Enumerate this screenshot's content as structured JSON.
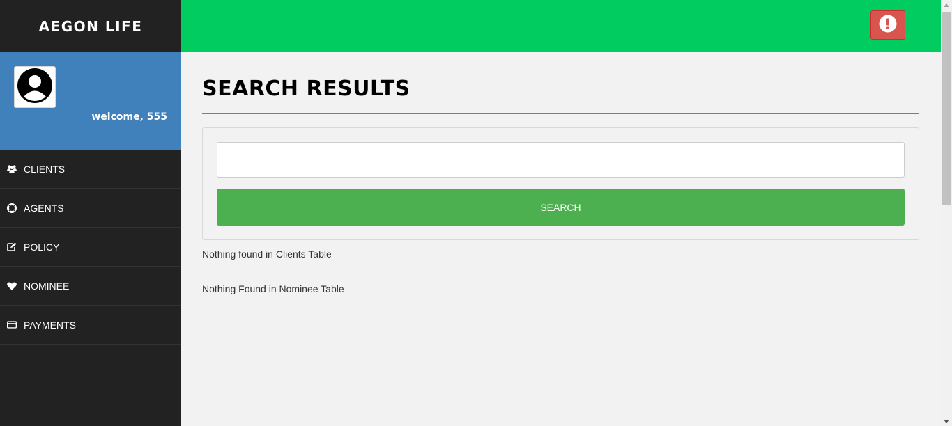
{
  "brand": {
    "title": "AEGON LIFE"
  },
  "profile": {
    "welcome": "welcome, 555"
  },
  "sidebar": {
    "items": [
      {
        "label": "CLIENTS",
        "icon": "users-icon"
      },
      {
        "label": "AGENTS",
        "icon": "life-ring-icon"
      },
      {
        "label": "POLICY",
        "icon": "edit-icon"
      },
      {
        "label": "NOMINEE",
        "icon": "heart-icon"
      },
      {
        "label": "PAYMENTS",
        "icon": "credit-card-icon"
      }
    ]
  },
  "header": {
    "alert_icon": "exclamation-circle-icon"
  },
  "main": {
    "title": "SEARCH RESULTS",
    "search": {
      "value": "",
      "placeholder": "",
      "button_label": "SEARCH"
    },
    "messages": {
      "clients": "Nothing found in Clients Table",
      "nominee": "Nothing Found in Nominee Table"
    }
  },
  "colors": {
    "sidebar_bg": "#222222",
    "profile_bg": "#4080bb",
    "topbar_bg": "#00cc60",
    "alert_btn": "#d9534f",
    "search_btn": "#4cb050",
    "title_rule": "#1db36b"
  }
}
